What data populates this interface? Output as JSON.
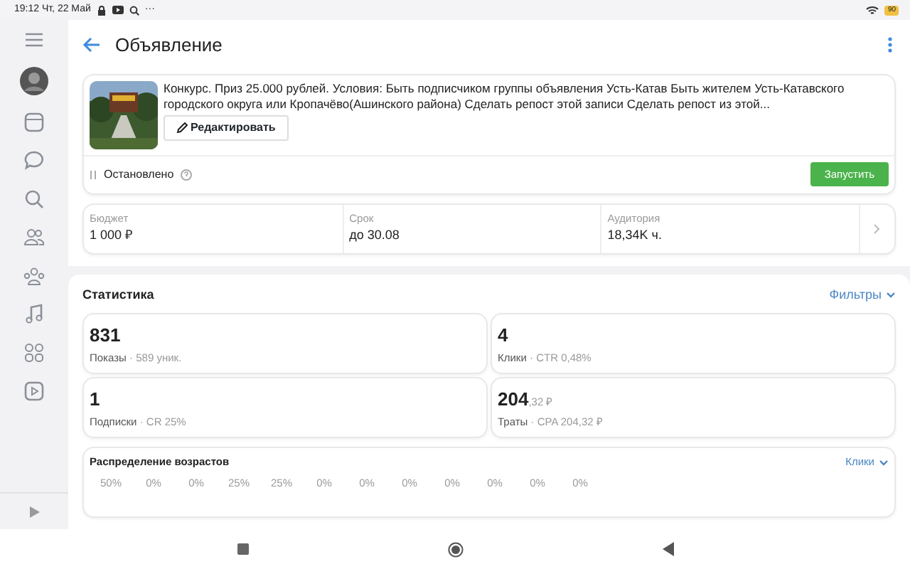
{
  "status_bar": {
    "time": "19:12 Чт, 22 Май",
    "more": "···",
    "battery": "90"
  },
  "header": {
    "title": "Объявление"
  },
  "ad": {
    "text": "Конкурс. Приз 25.000 рублей.  Условия: Быть подписчиком группы объявления Усть-Катав Быть жителем Усть-Катавского городского округа или Кропачёво(Ашинского района) Сделать репост этой записи Сделать репост из этой...",
    "edit_button": "Редактировать",
    "status": "Остановлено",
    "start_button": "Запустить"
  },
  "info": [
    {
      "label": "Бюджет",
      "value": "1 000 ₽"
    },
    {
      "label": "Срок",
      "value": "до 30.08"
    },
    {
      "label": "Аудитория",
      "value": "18,34K ч."
    }
  ],
  "statistics": {
    "title": "Статистика",
    "filters": "Фильтры",
    "tiles": [
      {
        "value": "831",
        "name": "Показы",
        "extra": "· 589 уник."
      },
      {
        "value": "4",
        "name": "Клики",
        "extra": "· CTR 0,48%"
      },
      {
        "value": "1",
        "name": "Подписки",
        "extra": "· CR 25%"
      },
      {
        "value": "204",
        "value_small": ",32 ₽",
        "name": "Траты",
        "extra": "· CPA 204,32 ₽"
      }
    ],
    "age": {
      "title": "Распределение возрастов",
      "metric": "Клики",
      "labels": [
        "50%",
        "0%",
        "0%",
        "25%",
        "25%",
        "0%",
        "0%",
        "0%",
        "0%",
        "0%",
        "0%",
        "0%"
      ]
    }
  }
}
